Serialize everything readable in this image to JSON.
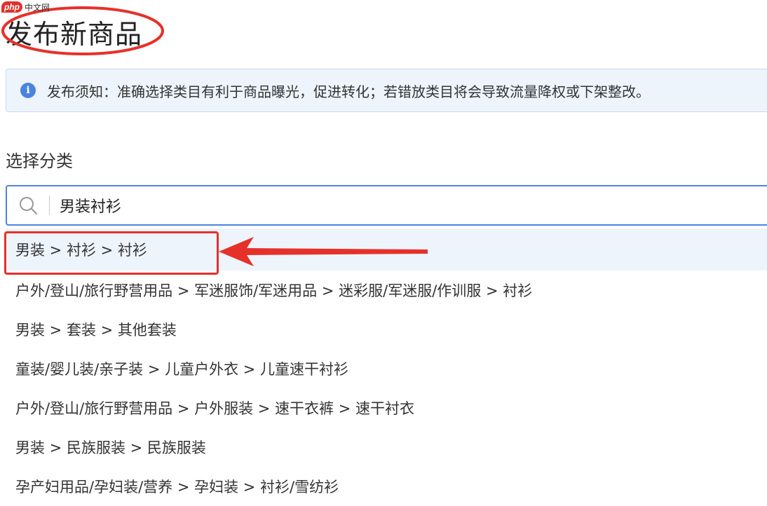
{
  "watermark": {
    "badge": "php",
    "text": "中文网"
  },
  "page": {
    "title": "发布新商品"
  },
  "notice": {
    "icon": "info-icon",
    "text": "发布须知：准确选择类目有利于商品曝光，促进转化；若错放类目将会导致流量降权或下架整改。"
  },
  "category": {
    "label": "选择分类",
    "search_value": "男装衬衫",
    "results": [
      "男装 > 衬衫 > 衬衫",
      "户外/登山/旅行野营用品 > 军迷服饰/军迷用品 > 迷彩服/军迷服/作训服 > 衬衫",
      "男装 > 套装 > 其他套装",
      "童装/婴儿装/亲子装 > 儿童户外衣 > 儿童速干衬衫",
      "户外/登山/旅行野营用品 > 户外服装 > 速干衣裤 > 速干衬衣",
      "男装 > 民族服装 > 民族服装",
      "孕产妇用品/孕妇装/营养 > 孕妇装 > 衬衫/雪纺衫"
    ]
  },
  "colors": {
    "accent": "#4a84de",
    "annotation": "#e6312a",
    "notice_bg": "#eef4fc"
  }
}
